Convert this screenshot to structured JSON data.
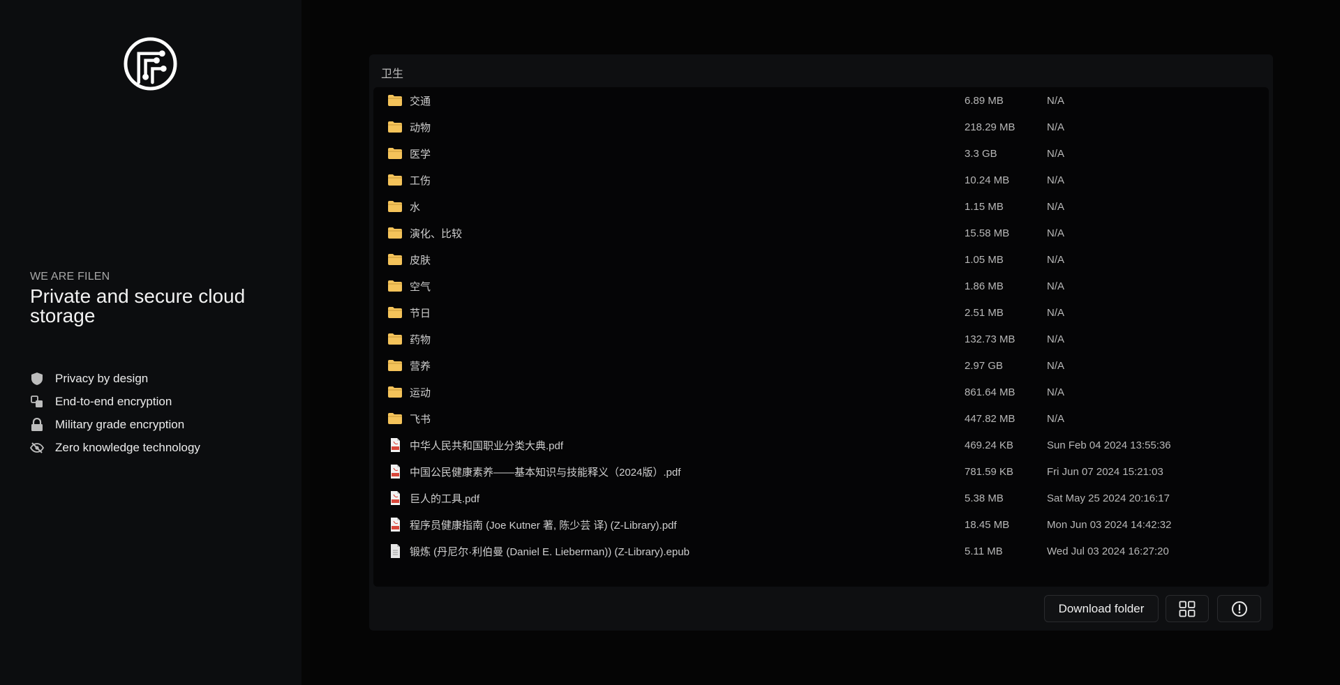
{
  "sidebar": {
    "tagline": "WE ARE FILEN",
    "headline": "Private and secure cloud storage",
    "features": [
      {
        "icon": "shield-icon",
        "label": "Privacy by design"
      },
      {
        "icon": "encryption-icon",
        "label": "End-to-end encryption"
      },
      {
        "icon": "lock-icon",
        "label": "Military grade encryption"
      },
      {
        "icon": "eye-off-icon",
        "label": "Zero knowledge technology"
      }
    ]
  },
  "folder": {
    "title": "卫生",
    "items": [
      {
        "type": "folder",
        "name": "交通",
        "size": "6.89 MB",
        "date": "N/A"
      },
      {
        "type": "folder",
        "name": "动物",
        "size": "218.29 MB",
        "date": "N/A"
      },
      {
        "type": "folder",
        "name": "医学",
        "size": "3.3 GB",
        "date": "N/A"
      },
      {
        "type": "folder",
        "name": "工伤",
        "size": "10.24 MB",
        "date": "N/A"
      },
      {
        "type": "folder",
        "name": "水",
        "size": "1.15 MB",
        "date": "N/A"
      },
      {
        "type": "folder",
        "name": "演化、比较",
        "size": "15.58 MB",
        "date": "N/A"
      },
      {
        "type": "folder",
        "name": "皮肤",
        "size": "1.05 MB",
        "date": "N/A"
      },
      {
        "type": "folder",
        "name": "空气",
        "size": "1.86 MB",
        "date": "N/A"
      },
      {
        "type": "folder",
        "name": "节日",
        "size": "2.51 MB",
        "date": "N/A"
      },
      {
        "type": "folder",
        "name": "药物",
        "size": "132.73 MB",
        "date": "N/A"
      },
      {
        "type": "folder",
        "name": "营养",
        "size": "2.97 GB",
        "date": "N/A"
      },
      {
        "type": "folder",
        "name": "运动",
        "size": "861.64 MB",
        "date": "N/A"
      },
      {
        "type": "folder",
        "name": "飞书",
        "size": "447.82 MB",
        "date": "N/A"
      },
      {
        "type": "pdf",
        "name": "中华人民共和国职业分类大典.pdf",
        "size": "469.24 KB",
        "date": "Sun Feb 04 2024 13:55:36"
      },
      {
        "type": "pdf",
        "name": "中国公民健康素养——基本知识与技能释义（2024版）.pdf",
        "size": "781.59 KB",
        "date": "Fri Jun 07 2024 15:21:03"
      },
      {
        "type": "pdf",
        "name": "巨人的工具.pdf",
        "size": "5.38 MB",
        "date": "Sat May 25 2024 20:16:17"
      },
      {
        "type": "pdf",
        "name": "程序员健康指南 (Joe Kutner 著, 陈少芸 译) (Z-Library).pdf",
        "size": "18.45 MB",
        "date": "Mon Jun 03 2024 14:42:32"
      },
      {
        "type": "file",
        "name": "锻炼 (丹尼尔·利伯曼 (Daniel E. Lieberman)) (Z-Library).epub",
        "size": "5.11 MB",
        "date": "Wed Jul 03 2024 16:27:20"
      }
    ]
  },
  "actions": {
    "download_label": "Download folder",
    "grid_icon": "grid-view-icon",
    "info_icon": "info-circle-icon"
  },
  "colors": {
    "folder": "#f4c35a",
    "pdf_red": "#d9473b",
    "sidebar_bg": "#0c0d0f",
    "panel_bg": "#0e0f11"
  }
}
